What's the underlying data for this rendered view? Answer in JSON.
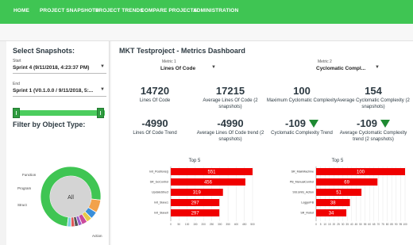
{
  "nav": {
    "items": [
      "HOME",
      "PROJECT SNAPSHOTS",
      "PROJECT TRENDS",
      "COMPARE PROJECTS",
      "ADMINISTRATION"
    ]
  },
  "sidebar": {
    "title": "Select Snapshots:",
    "start_label": "Start",
    "start_value": "Sprint 4 (9/11/2018, 4:23:37 PM)",
    "end_label": "End",
    "end_value": "Sprint 1 (V0.1.0.0 / 9/11/2018, 5:...",
    "filter_title": "Filter by Object Type:",
    "donut_center": "All",
    "donut_labels": [
      "Function",
      "Program",
      "Struct",
      "Action"
    ]
  },
  "donut_data": {
    "segments": [
      {
        "name": "Action",
        "value": 75,
        "color": "#3fc553"
      },
      {
        "name": "Struct",
        "value": 7,
        "color": "#f2a24b"
      },
      {
        "name": "Program",
        "value": 4,
        "color": "#3a8fd9"
      },
      {
        "name": "Function",
        "value": 3,
        "color": "#e7c94c"
      },
      {
        "name": "",
        "value": 3,
        "color": "#cc4a9c"
      },
      {
        "name": "",
        "value": 2,
        "color": "#9d5dc9"
      },
      {
        "name": "",
        "value": 2,
        "color": "#555555"
      },
      {
        "name": "",
        "value": 2,
        "color": "#e05757"
      },
      {
        "name": "",
        "value": 2,
        "color": "#7fd0e0"
      }
    ]
  },
  "main": {
    "title": "MKT Testproject - Metrics Dashboard",
    "metric1_label": "Metric 1",
    "metric1_value": "Lines Of Code",
    "metric2_label": "Metric 2",
    "metric2_value": "Cyclomatic Compl...",
    "cards": [
      {
        "value": "14720",
        "label": "Lines Of Code"
      },
      {
        "value": "17215",
        "label": "Average Lines Of Code (2 snapshots)"
      },
      {
        "value": "100",
        "label": "Maximum Cyclomatic Complexity"
      },
      {
        "value": "154",
        "label": "Average Cyclomatic Complexity (2 snapshots)"
      },
      {
        "value": "-4990",
        "label": "Lines Of Code Trend"
      },
      {
        "value": "-4990",
        "label": "Average Lines Of Code trend (2 snapshots)"
      },
      {
        "value": "-109",
        "label": "Cyclomatic Complexity Trend"
      },
      {
        "value": "-109",
        "label": "Average Cyclomatic Complexity trend (2 snapshots)"
      }
    ]
  },
  "chart_data": [
    {
      "type": "bar",
      "title": "Top 5",
      "categories": [
        "Init_Positions()",
        "SR_GoControl",
        "UpdateStruct",
        "Init_Slave1",
        "Init_Slave0"
      ],
      "values": [
        551,
        456,
        319,
        297,
        297
      ],
      "xlim": [
        0,
        500
      ],
      "ticks": [
        0,
        50,
        100,
        150,
        200,
        250,
        300,
        350,
        400,
        450,
        500
      ],
      "bar_color": "#f00000",
      "orientation": "horizontal"
    },
    {
      "type": "bar",
      "title": "Top 5",
      "categories": [
        "SR_MainMachine",
        "PB_ManualControl",
        "Std.Units_Action",
        "LoggerFB",
        "SR_Robot"
      ],
      "values": [
        100,
        69,
        51,
        38,
        34
      ],
      "xlim": [
        0,
        100
      ],
      "ticks": [
        0,
        5,
        10,
        15,
        20,
        25,
        30,
        35,
        40,
        45,
        50,
        55,
        60,
        65,
        70,
        75,
        80,
        85,
        90,
        95,
        100
      ],
      "bar_color": "#f00000",
      "orientation": "horizontal"
    }
  ]
}
